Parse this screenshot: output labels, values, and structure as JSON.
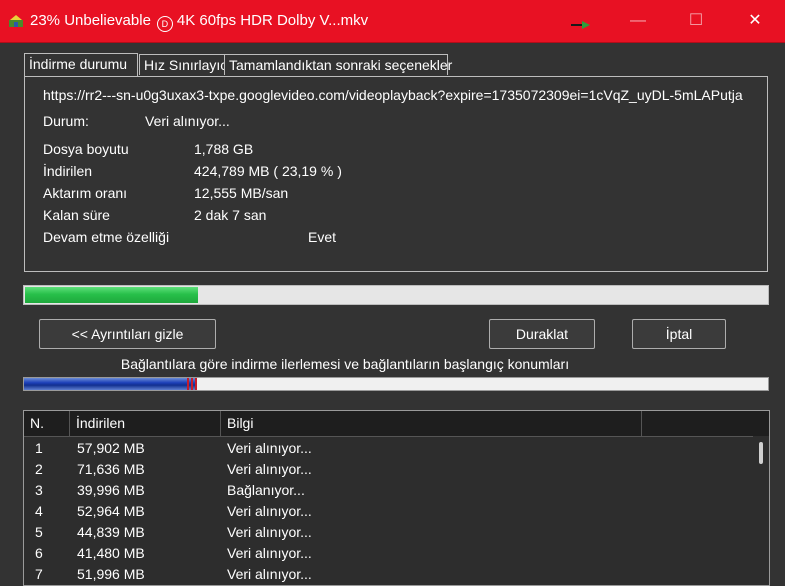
{
  "window": {
    "title_prefix": "23% Unbelievable",
    "title_suffix": "4K 60fps HDR Dolby V...mkv",
    "dolby_glyph": "D",
    "minimize_glyph": "—",
    "maximize_glyph": "☐",
    "close_glyph": "✕",
    "accent_color": "#e81123"
  },
  "tabs": [
    {
      "label": "İndirme durumu",
      "active": true
    },
    {
      "label": "Hız Sınırlayıcı",
      "active": false
    },
    {
      "label": "Tamamlandıktan sonraki seçenekler",
      "active": false
    }
  ],
  "status": {
    "url": "https://rr2---sn-u0g3uxax3-txpe.googlevideo.com/videoplayback?expire=1735072309ei=1cVqZ_uyDL-5mLAPutja",
    "state_label": "Durum:",
    "state_value": "Veri alınıyor...",
    "size_label": "Dosya boyutu",
    "size_value": "1,788  GB",
    "downloaded_label": "İndirilen",
    "downloaded_value": "424,789  MB  ( 23,19 % )",
    "rate_label": "Aktarım oranı",
    "rate_value": "12,555  MB/san",
    "remaining_label": "Kalan süre",
    "remaining_value": "2 dak 7 san",
    "resume_label": "Devam etme özelliği",
    "resume_value": "Evet"
  },
  "progress": {
    "fraction": 0.2319,
    "color": "#28c04a"
  },
  "buttons": {
    "hide_details": "<< Ayrıntıları gizle",
    "pause": "Duraklat",
    "cancel": "İptal"
  },
  "connections": {
    "label": "Bağlantılara göre indirme ilerlemesi ve bağlantıların başlangıç konumları",
    "fraction": 0.2319,
    "color": "#1c3fb8"
  },
  "table": {
    "headers": [
      "N.",
      "İndirilen",
      "Bilgi"
    ],
    "rows": [
      {
        "n": "1",
        "downloaded": "57,902  MB",
        "info": "Veri alınıyor..."
      },
      {
        "n": "2",
        "downloaded": "71,636  MB",
        "info": "Veri alınıyor..."
      },
      {
        "n": "3",
        "downloaded": "39,996  MB",
        "info": "Bağlanıyor..."
      },
      {
        "n": "4",
        "downloaded": "52,964  MB",
        "info": "Veri alınıyor..."
      },
      {
        "n": "5",
        "downloaded": "44,839  MB",
        "info": "Veri alınıyor..."
      },
      {
        "n": "6",
        "downloaded": "41,480  MB",
        "info": "Veri alınıyor..."
      },
      {
        "n": "7",
        "downloaded": "51,996  MB",
        "info": "Veri alınıyor..."
      }
    ]
  }
}
